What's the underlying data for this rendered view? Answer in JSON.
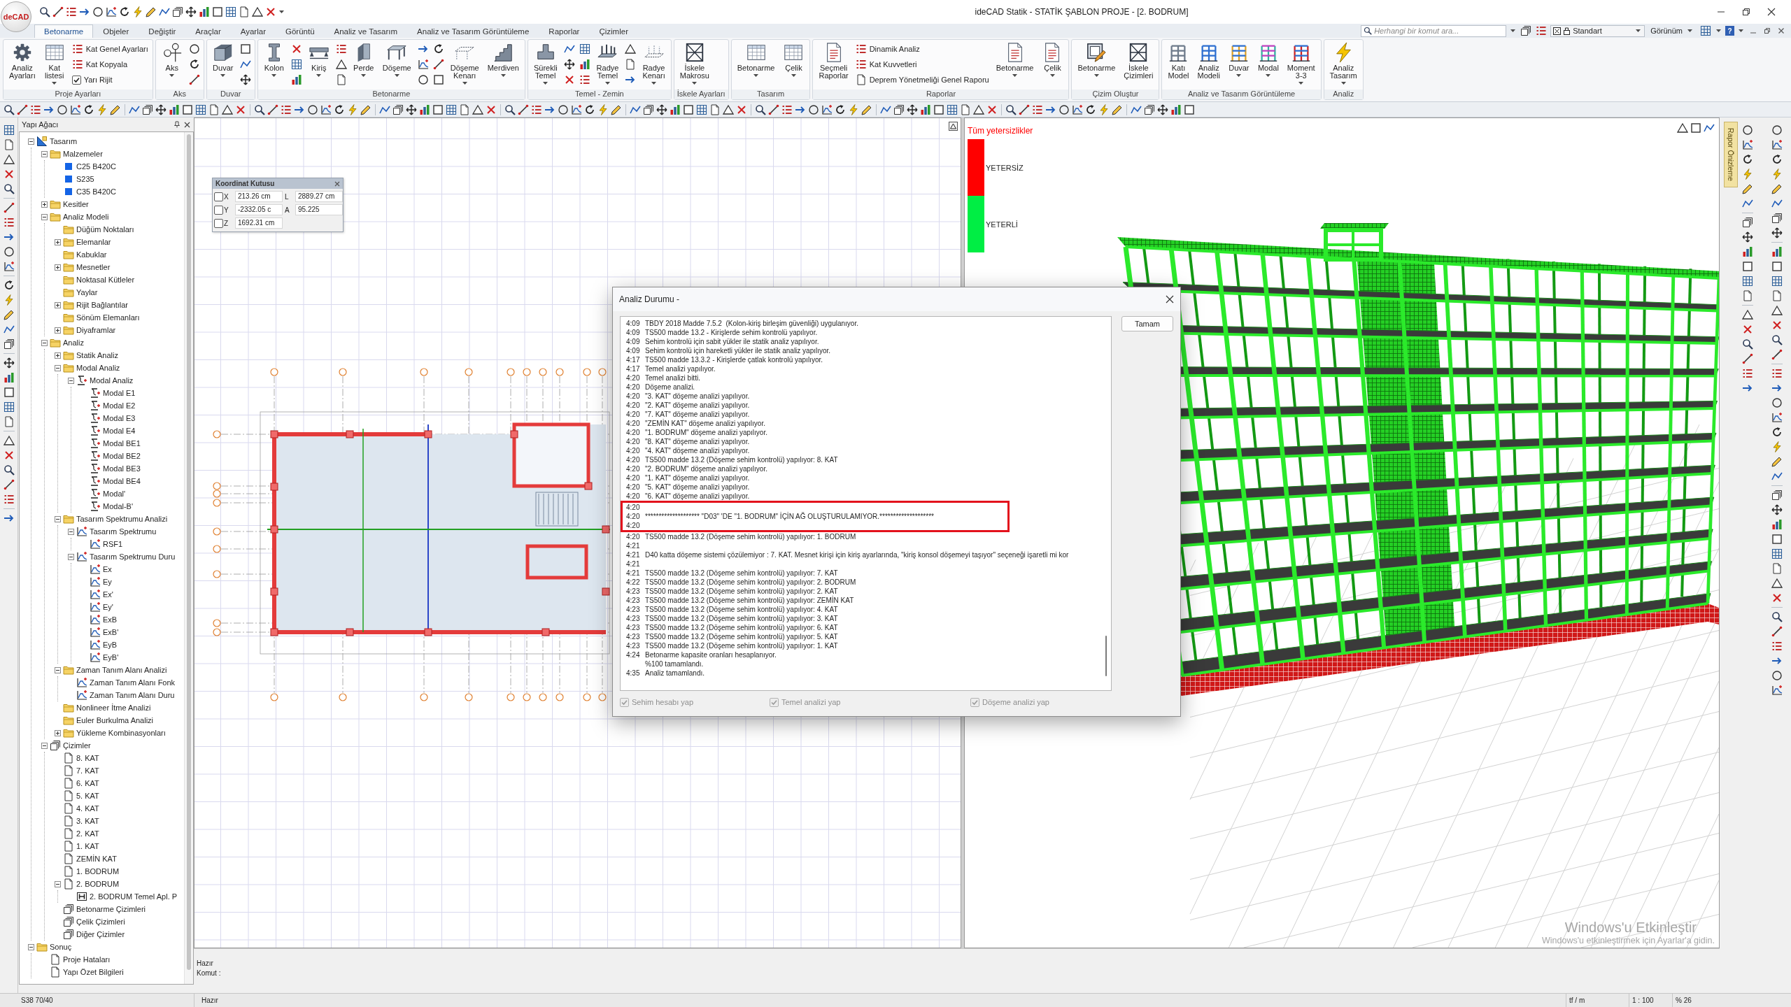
{
  "window": {
    "title": "ideCAD Statik - STATİK ŞABLON PROJE - [2. BODRUM]",
    "logo": "deCAD"
  },
  "ribbon_tabs": [
    {
      "label": "Betonarme",
      "selected": true
    },
    {
      "label": "Objeler",
      "selected": false
    },
    {
      "label": "Değiştir",
      "selected": false
    },
    {
      "label": "Araçlar",
      "selected": false
    },
    {
      "label": "Ayarlar",
      "selected": false
    },
    {
      "label": "Görüntü",
      "selected": false
    },
    {
      "label": "Analiz ve Tasarım",
      "selected": false
    },
    {
      "label": "Analiz ve Tasarım Görüntüleme",
      "selected": false
    },
    {
      "label": "Raporlar",
      "selected": false
    },
    {
      "label": "Çizimler",
      "selected": false
    }
  ],
  "command_search": {
    "placeholder": "Herhangi bir komut ara..."
  },
  "style_selector": {
    "value": "Standart"
  },
  "view_menu": {
    "label": "Görünüm"
  },
  "help_button": {
    "label": "?"
  },
  "ribbon_groups": [
    {
      "label": "Proje Ayarları",
      "items": [
        {
          "kind": "large",
          "label": "Analiz Ayarları",
          "dropdown": false
        },
        {
          "kind": "large",
          "label": "Kat listesi",
          "dropdown": true
        },
        {
          "kind": "stack",
          "entries": [
            {
              "kind": "command",
              "label": "Kat Genel Ayarları"
            },
            {
              "kind": "command",
              "label": "Kat Kopyala"
            },
            {
              "kind": "checkbox",
              "label": "Yarı Rijit",
              "checked": true
            }
          ]
        }
      ]
    },
    {
      "label": "Aks",
      "items": [
        {
          "kind": "large",
          "label": "Aks",
          "dropdown": true
        },
        {
          "kind": "tools"
        }
      ]
    },
    {
      "label": "Duvar",
      "items": [
        {
          "kind": "large",
          "label": "Duvar",
          "dropdown": true
        },
        {
          "kind": "tools"
        }
      ]
    },
    {
      "label": "Betonarme",
      "items": [
        {
          "kind": "large",
          "label": "Kolon",
          "dropdown": true
        },
        {
          "kind": "tools"
        },
        {
          "kind": "large",
          "label": "Kiriş",
          "dropdown": true
        },
        {
          "kind": "tools"
        },
        {
          "kind": "large",
          "label": "Perde",
          "dropdown": true
        },
        {
          "kind": "large",
          "label": "Döşeme",
          "dropdown": true
        },
        {
          "kind": "tools"
        },
        {
          "kind": "tools"
        },
        {
          "kind": "large",
          "label": "Döşeme Kenarı",
          "dropdown": true
        },
        {
          "kind": "large",
          "label": "Merdiven",
          "dropdown": true
        }
      ]
    },
    {
      "label": "Temel - Zemin",
      "items": [
        {
          "kind": "large",
          "label": "Sürekli Temel",
          "dropdown": true
        },
        {
          "kind": "tools"
        },
        {
          "kind": "tools"
        },
        {
          "kind": "large",
          "label": "Radye Temel",
          "dropdown": true
        },
        {
          "kind": "tools"
        },
        {
          "kind": "large",
          "label": "Radye Kenarı",
          "dropdown": true
        }
      ]
    },
    {
      "label": "İskele Ayarları",
      "items": [
        {
          "kind": "large",
          "label": "İskele Makrosu",
          "dropdown": true
        }
      ]
    },
    {
      "label": "Tasarım",
      "items": [
        {
          "kind": "large",
          "label": "Betonarme",
          "dropdown": true
        },
        {
          "kind": "large",
          "label": "Çelik",
          "dropdown": true
        }
      ]
    },
    {
      "label": "Raporlar",
      "items": [
        {
          "kind": "large",
          "label": "Seçmeli Raporlar",
          "dropdown": false
        },
        {
          "kind": "stack",
          "entries": [
            {
              "kind": "command",
              "label": "Dinamik Analiz"
            },
            {
              "kind": "command",
              "label": "Kat Kuvvetleri"
            },
            {
              "kind": "command",
              "label": "Deprem Yönetmeliği Genel Raporu"
            }
          ]
        },
        {
          "kind": "large",
          "label": "Betonarme",
          "dropdown": true
        },
        {
          "kind": "large",
          "label": "Çelik",
          "dropdown": true
        }
      ]
    },
    {
      "label": "Çizim Oluştur",
      "items": [
        {
          "kind": "large",
          "label": "Betonarme",
          "dropdown": true
        },
        {
          "kind": "large",
          "label": "İskele Çizimleri",
          "dropdown": false
        }
      ]
    },
    {
      "label": "Analiz ve Tasarım Görüntüleme",
      "items": [
        {
          "kind": "large",
          "label": "Katı Model",
          "dropdown": false
        },
        {
          "kind": "large",
          "label": "Analiz Modeli",
          "dropdown": false
        },
        {
          "kind": "large",
          "label": "Duvar",
          "dropdown": true
        },
        {
          "kind": "large",
          "label": "Modal",
          "dropdown": true
        },
        {
          "kind": "large",
          "label": "Moment 3-3",
          "dropdown": true
        }
      ]
    },
    {
      "label": "Analiz",
      "items": [
        {
          "kind": "large",
          "label": "Analiz Tasarım",
          "dropdown": true
        }
      ]
    }
  ],
  "structure_tree": {
    "title": "Yapı Ağacı",
    "items": [
      {
        "label": "Tasarım",
        "kind": "root",
        "expanded": true,
        "children": [
          {
            "label": "Malzemeler",
            "kind": "folder",
            "expanded": true,
            "children": [
              {
                "label": "C25 B420C",
                "kind": "material"
              },
              {
                "label": "S235",
                "kind": "material"
              },
              {
                "label": "C35 B420C",
                "kind": "material"
              }
            ]
          },
          {
            "label": "Kesitler",
            "kind": "folder",
            "expanded": false
          },
          {
            "label": "Analiz Modeli",
            "kind": "folder",
            "expanded": true,
            "children": [
              {
                "label": "Düğüm Noktaları",
                "kind": "folder"
              },
              {
                "label": "Elemanlar",
                "kind": "folder",
                "expanded": false
              },
              {
                "label": "Kabuklar",
                "kind": "folder"
              },
              {
                "label": "Mesnetler",
                "kind": "folder",
                "expanded": false
              },
              {
                "label": "Noktasal Kütleler",
                "kind": "folder"
              },
              {
                "label": "Yaylar",
                "kind": "folder"
              },
              {
                "label": "Rijit Bağlantılar",
                "kind": "folder",
                "expanded": false
              },
              {
                "label": "Sönüm Elemanları",
                "kind": "folder"
              },
              {
                "label": "Diyaframlar",
                "kind": "folder",
                "expanded": false
              }
            ]
          },
          {
            "label": "Analiz",
            "kind": "folder",
            "expanded": true,
            "children": [
              {
                "label": "Statik Analiz",
                "kind": "folder",
                "expanded": false
              },
              {
                "label": "Modal Analiz",
                "kind": "folder",
                "expanded": true,
                "children": [
                  {
                    "label": "Modal Analiz",
                    "kind": "mode",
                    "expanded": true,
                    "children": [
                      {
                        "label": "Modal E1",
                        "kind": "mode"
                      },
                      {
                        "label": "Modal E2",
                        "kind": "mode"
                      },
                      {
                        "label": "Modal E3",
                        "kind": "mode"
                      },
                      {
                        "label": "Modal E4",
                        "kind": "mode"
                      },
                      {
                        "label": "Modal BE1",
                        "kind": "mode"
                      },
                      {
                        "label": "Modal BE2",
                        "kind": "mode"
                      },
                      {
                        "label": "Modal BE3",
                        "kind": "mode"
                      },
                      {
                        "label": "Modal BE4",
                        "kind": "mode"
                      },
                      {
                        "label": "Modal'",
                        "kind": "mode"
                      },
                      {
                        "label": "Modal-B'",
                        "kind": "mode"
                      }
                    ]
                  }
                ]
              },
              {
                "label": "Tasarım Spektrumu Analizi",
                "kind": "folder",
                "expanded": true,
                "children": [
                  {
                    "label": "Tasarım Spektrumu",
                    "kind": "spectrum",
                    "expanded": true,
                    "children": [
                      {
                        "label": "RSF1",
                        "kind": "spectrum"
                      }
                    ]
                  },
                  {
                    "label": "Tasarım Spektrumu Duru",
                    "kind": "spectrum",
                    "expanded": true,
                    "children": [
                      {
                        "label": "Ex",
                        "kind": "spectrum"
                      },
                      {
                        "label": "Ey",
                        "kind": "spectrum"
                      },
                      {
                        "label": "Ex'",
                        "kind": "spectrum"
                      },
                      {
                        "label": "Ey'",
                        "kind": "spectrum"
                      },
                      {
                        "label": "ExB",
                        "kind": "spectrum"
                      },
                      {
                        "label": "ExB'",
                        "kind": "spectrum"
                      },
                      {
                        "label": "EyB",
                        "kind": "spectrum"
                      },
                      {
                        "label": "EyB'",
                        "kind": "spectrum"
                      }
                    ]
                  }
                ]
              },
              {
                "label": "Zaman Tanım Alanı Analizi",
                "kind": "folder",
                "expanded": true,
                "children": [
                  {
                    "label": "Zaman Tanım Alanı Fonk",
                    "kind": "spectrum"
                  },
                  {
                    "label": "Zaman Tanım Alanı Duru",
                    "kind": "spectrum"
                  }
                ]
              },
              {
                "label": "Nonlineer İtme Analizi",
                "kind": "folder"
              },
              {
                "label": "Euler Burkulma Analizi",
                "kind": "folder"
              },
              {
                "label": "Yükleme Kombinasyonları",
                "kind": "folder",
                "expanded": false
              }
            ]
          },
          {
            "label": "Çizimler",
            "kind": "stack",
            "expanded": true,
            "children": [
              {
                "label": "8. KAT",
                "kind": "sheet"
              },
              {
                "label": "7. KAT",
                "kind": "sheet"
              },
              {
                "label": "6. KAT",
                "kind": "sheet"
              },
              {
                "label": "5. KAT",
                "kind": "sheet"
              },
              {
                "label": "4. KAT",
                "kind": "sheet"
              },
              {
                "label": "3. KAT",
                "kind": "sheet"
              },
              {
                "label": "2. KAT",
                "kind": "sheet"
              },
              {
                "label": "1. KAT",
                "kind": "sheet"
              },
              {
                "label": "ZEMİN KAT",
                "kind": "sheet"
              },
              {
                "label": "1. BODRUM",
                "kind": "sheet"
              },
              {
                "label": "2. BODRUM",
                "kind": "sheet",
                "expanded": true,
                "children": [
                  {
                    "label": "2. BODRUM Temel Apl. P",
                    "kind": "plan"
                  }
                ]
              },
              {
                "label": "Betonarme Çizimleri",
                "kind": "stack"
              },
              {
                "label": "Çelik Çizimleri",
                "kind": "stack"
              },
              {
                "label": "Diğer Çizimler",
                "kind": "stack"
              }
            ]
          }
        ]
      },
      {
        "label": "Sonuç",
        "kind": "folder",
        "expanded": true,
        "children": [
          {
            "label": "Proje Hataları",
            "kind": "sheet"
          },
          {
            "label": "Yapı Özet Bilgileri",
            "kind": "sheet"
          }
        ]
      }
    ]
  },
  "coordinate_box": {
    "title": "Koordinat Kutusu",
    "axes": [
      {
        "label": "X",
        "checked": false,
        "value": "213.26 cm"
      },
      {
        "label": "Y",
        "checked": false,
        "value": "-2332.05 c"
      },
      {
        "label": "Z",
        "checked": false,
        "value": "1692.31 cm"
      }
    ],
    "measures": [
      {
        "label": "L",
        "value": "2889.27 cm"
      },
      {
        "label": "A",
        "value": "95.225"
      }
    ]
  },
  "legend": {
    "title": "Tüm yetersizlikler",
    "items": [
      {
        "label": "YETERSİZ",
        "color": "#ff0000"
      },
      {
        "label": "YETERLİ",
        "color": "#00ee44"
      }
    ]
  },
  "side_panel_tab": {
    "label": "Rapor Önizleme"
  },
  "analysis_dialog": {
    "title": "Analiz Durumu -",
    "log": [
      {
        "time": "4:09",
        "text": "TBDY 2018 Madde 7.5.2  (Kolon-kiriş birleşim güvenliği) uygulanıyor.",
        "marked": false
      },
      {
        "time": "4:09",
        "text": "TS500 madde 13.2 - Kirişlerde sehim kontrolü yapılıyor.",
        "marked": false
      },
      {
        "time": "4:09",
        "text": "Sehim kontrolü için sabit yükler ile statik analiz yapılıyor.",
        "marked": false
      },
      {
        "time": "4:09",
        "text": "Sehim kontrolü için hareketli yükler ile statik analiz yapılıyor.",
        "marked": false
      },
      {
        "time": "4:17",
        "text": "TS500 madde 13.3.2 - Kirişlerde çatlak kontrolü yapılıyor.",
        "marked": false
      },
      {
        "time": "4:17",
        "text": "Temel analizi yapılıyor.",
        "marked": false
      },
      {
        "time": "4:20",
        "text": "Temel analizi bitti.",
        "marked": false
      },
      {
        "time": "4:20",
        "text": "Döşeme analizi.",
        "marked": false
      },
      {
        "time": "4:20",
        "text": "\"3. KAT\" döşeme analizi yapılıyor.",
        "marked": false
      },
      {
        "time": "4:20",
        "text": "\"2. KAT\" döşeme analizi yapılıyor.",
        "marked": false
      },
      {
        "time": "4:20",
        "text": "\"7. KAT\" döşeme analizi yapılıyor.",
        "marked": false
      },
      {
        "time": "4:20",
        "text": "\"ZEMİN KAT\" döşeme analizi yapılıyor.",
        "marked": false
      },
      {
        "time": "4:20",
        "text": "\"1. BODRUM\" döşeme analizi yapılıyor.",
        "marked": false
      },
      {
        "time": "4:20",
        "text": "\"8. KAT\" döşeme analizi yapılıyor.",
        "marked": false
      },
      {
        "time": "4:20",
        "text": "\"4. KAT\" döşeme analizi yapılıyor.",
        "marked": false
      },
      {
        "time": "4:20",
        "text": "TS500 madde 13.2 (Döşeme sehim kontrolü) yapılıyor: 8. KAT",
        "marked": false
      },
      {
        "time": "4:20",
        "text": "\"2. BODRUM\" döşeme analizi yapılıyor.",
        "marked": false
      },
      {
        "time": "4:20",
        "text": "\"1. KAT\" döşeme analizi yapılıyor.",
        "marked": false
      },
      {
        "time": "4:20",
        "text": "\"5. KAT\" döşeme analizi yapılıyor.",
        "marked": false
      },
      {
        "time": "4:20",
        "text": "\"6. KAT\" döşeme analizi yapılıyor.",
        "marked": false
      },
      {
        "time": "4:20",
        "marked": true
      },
      {
        "time": "4:20",
        "text": "******************** \"D03\" 'DE \"1. BODRUM\" İÇİN AĞ OLUŞTURULAMIYOR.********************",
        "marked": true
      },
      {
        "time": "4:20",
        "marked": true
      },
      {
        "time": "4:20",
        "text": "TS500 madde 13.2 (Döşeme sehim kontrolü) yapılıyor: 1. BODRUM",
        "marked": false
      },
      {
        "time": "4:21",
        "marked": false
      },
      {
        "time": "4:21",
        "text": "D40 katta döşeme sistemi çözülemiyor : 7. KAT. Mesnet kirişi için kiriş ayarlarında, \"kiriş konsol döşemeyi taşıyor\" seçeneği işaretli mi kor",
        "marked": false
      },
      {
        "time": "4:21",
        "marked": false
      },
      {
        "time": "4:21",
        "text": "TS500 madde 13.2 (Döşeme sehim kontrolü) yapılıyor: 7. KAT",
        "marked": false
      },
      {
        "time": "4:22",
        "text": "TS500 madde 13.2 (Döşeme sehim kontrolü) yapılıyor: 2. BODRUM",
        "marked": false
      },
      {
        "time": "4:23",
        "text": "TS500 madde 13.2 (Döşeme sehim kontrolü) yapılıyor: 2. KAT",
        "marked": false
      },
      {
        "time": "4:23",
        "text": "TS500 madde 13.2 (Döşeme sehim kontrolü) yapılıyor: ZEMİN KAT",
        "marked": false
      },
      {
        "time": "4:23",
        "text": "TS500 madde 13.2 (Döşeme sehim kontrolü) yapılıyor: 4. KAT",
        "marked": false
      },
      {
        "time": "4:23",
        "text": "TS500 madde 13.2 (Döşeme sehim kontrolü) yapılıyor: 3. KAT",
        "marked": false
      },
      {
        "time": "4:23",
        "text": "TS500 madde 13.2 (Döşeme sehim kontrolü) yapılıyor: 6. KAT",
        "marked": false
      },
      {
        "time": "4:23",
        "text": "TS500 madde 13.2 (Döşeme sehim kontrolü) yapılıyor: 5. KAT",
        "marked": false
      },
      {
        "time": "4:23",
        "text": "TS500 madde 13.2 (Döşeme sehim kontrolü) yapılıyor: 1. KAT",
        "marked": false
      },
      {
        "time": "4:24",
        "text": "Betonarme kapasite oranları hesaplanıyor.",
        "marked": false
      },
      {
        "text": "%100 tamamlandı.",
        "marked": false
      },
      {
        "time": "4:35",
        "text": "Analiz tamamlandı.",
        "marked": false
      }
    ],
    "ok_button": "Tamam",
    "options": [
      {
        "label": "Sehim hesabı yap",
        "checked": true,
        "disabled": true
      },
      {
        "label": "Temel analizi yap",
        "checked": true,
        "disabled": true
      },
      {
        "label": "Döşeme analizi yap",
        "checked": true,
        "disabled": true
      }
    ]
  },
  "command_area": {
    "status": "Hazır",
    "prompt": "Komut :"
  },
  "status_bar": {
    "selection": "S38 70/40",
    "state": "Hazır",
    "unit": "tf / m",
    "scale": "1 : 100",
    "zoom": "% 26"
  },
  "activation_notice": {
    "title": "Windows'u Etkinleştir",
    "text": "Windows'u etkinleştirmek için Ayarlar'a gidin."
  }
}
